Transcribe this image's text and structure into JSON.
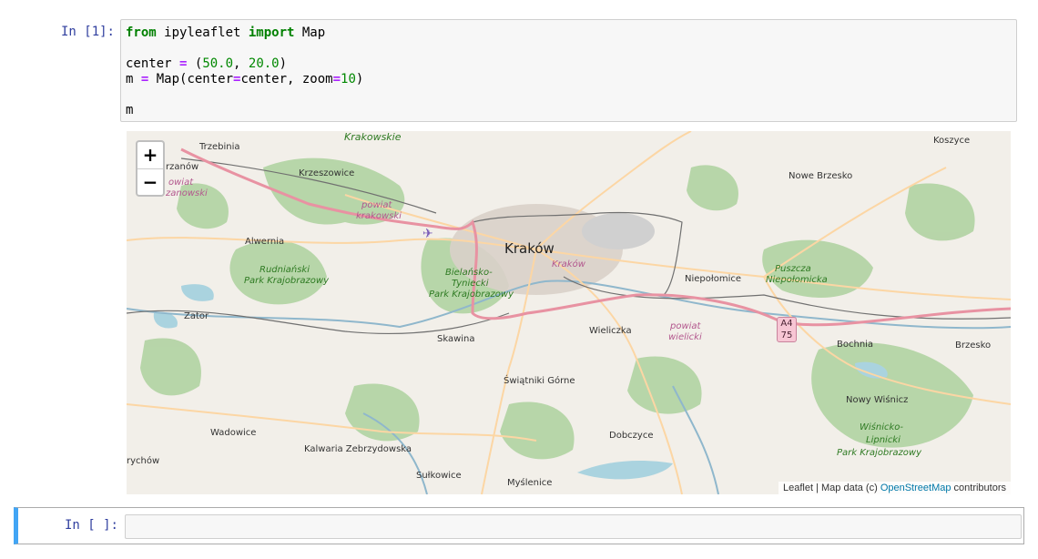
{
  "cell1": {
    "prompt": "In [1]:",
    "code": {
      "line1": {
        "kw1": "from",
        "mod": " ipyleaflet ",
        "kw2": "import",
        "name": " Map"
      },
      "line3": {
        "var": "center ",
        "op": "=",
        "open": " (",
        "n1": "50.0",
        "sep": ", ",
        "n2": "20.0",
        "close": ")"
      },
      "line4": {
        "var": "m ",
        "op": "=",
        "call": " Map(center",
        "op2": "=",
        "mid": "center, zoom",
        "op3": "=",
        "num": "10",
        "close": ")"
      },
      "line6": "m"
    }
  },
  "map": {
    "zoom_in": "+",
    "zoom_out": "−",
    "places": {
      "trzebinia": "Trzebinia",
      "chrzanow": "rzanów",
      "powiat_chrzanowski_1": "owiat",
      "powiat_chrzanowski_2": "zanowski",
      "krakowskie": "Krakowskie",
      "krzeszowice": "Krzeszowice",
      "powiat_krakowski_1": "powiat",
      "powiat_krakowski_2": "krakowski",
      "alwernia": "Alwernia",
      "rudnianski_1": "Rudniański",
      "rudnianski_2": "Park Krajobrazowy",
      "krakow": "Kraków",
      "krakow_district": "Kraków",
      "bielansko_1": "Bielańsko-",
      "bielansko_2": "Tyniecki",
      "bielansko_3": "Park Krajobrazowy",
      "zator": "Zator",
      "skawina": "Skawina",
      "wieliczka": "Wieliczka",
      "powiat_wielicki_1": "powiat",
      "powiat_wielicki_2": "wielicki",
      "niepolomice": "Niepołomice",
      "puszcza_1": "Puszcza",
      "puszcza_2": "Niepołomicka",
      "koszyce": "Koszyce",
      "nowe_brzesko": "Nowe Brzesko",
      "bochnia": "Bochnia",
      "brzesko": "Brzesko",
      "swiatniki": "Świątniki Górne",
      "nowy_wisnicz": "Nowy Wiśnicz",
      "wisnicko_1": "Wiśnicko-",
      "wisnicko_2": "Lipnicki",
      "wisnicko_3": "Park Krajobrazowy",
      "wadowice": "Wadowice",
      "kalwaria": "Kalwaria Zebrzydowska",
      "dobczyce": "Dobczyce",
      "sulkowice": "Sułkowice",
      "myslenice": "Myślenice",
      "andrychow": "rychów"
    },
    "road_shield": {
      "line1": "A4",
      "line2": "75"
    },
    "attribution": {
      "leaflet": "Leaflet",
      "sep": " | Map data (c) ",
      "osm": "OpenStreetMap",
      "contributors": " contributors"
    },
    "colors": {
      "land": "#f2efe9",
      "forest": "#add19e",
      "water": "#aad3df",
      "motorway": "#e892a2",
      "primary": "#fcd6a4",
      "urban": "#d9d0c9"
    }
  },
  "cell2": {
    "prompt": "In [ ]:",
    "value": ""
  }
}
